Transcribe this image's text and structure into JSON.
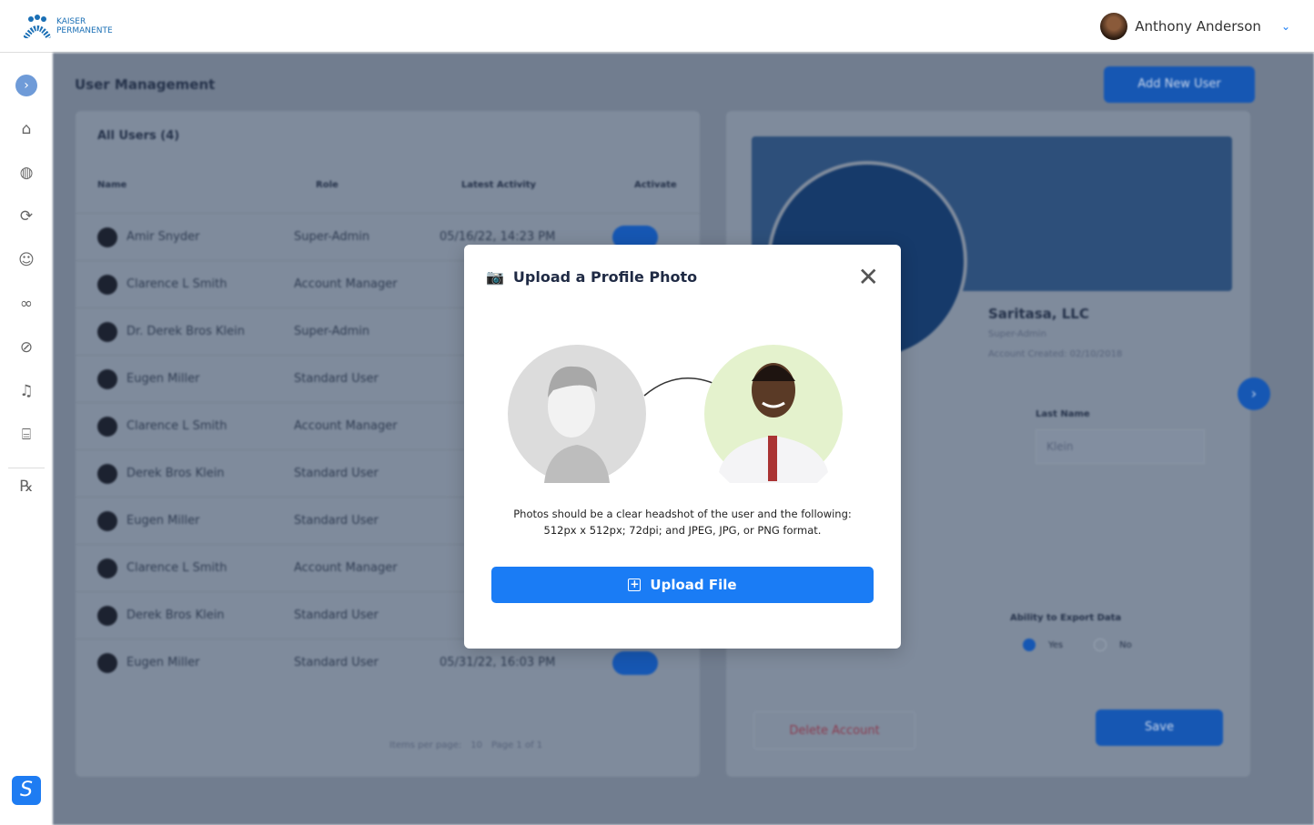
{
  "header": {
    "logo_line1": "KAISER",
    "logo_line2": "PERMANENTE",
    "user_name": "Anthony Anderson"
  },
  "sidebar": {
    "items": [
      "home-icon",
      "globe-icon",
      "sync-icon",
      "user-icon",
      "binoculars-icon",
      "pills-icon",
      "bell-icon",
      "bank-icon",
      "rx-icon"
    ],
    "brand": "S"
  },
  "page": {
    "title": "User Management",
    "add_button": "Add New User",
    "list_title": "All Users (4)",
    "columns": [
      "Name",
      "Role",
      "Latest Activity",
      "Activate"
    ],
    "rows": [
      {
        "name": "Amir Snyder",
        "role": "Super-Admin",
        "activity": "05/16/22, 14:23 PM"
      },
      {
        "name": "Clarence L Smith",
        "role": "Account Manager",
        "activity": ""
      },
      {
        "name": "Dr. Derek Bros Klein",
        "role": "Super-Admin",
        "activity": ""
      },
      {
        "name": "Eugen Miller",
        "role": "Standard User",
        "activity": ""
      },
      {
        "name": "Clarence L Smith",
        "role": "Account Manager",
        "activity": ""
      },
      {
        "name": "Derek Bros Klein",
        "role": "Standard User",
        "activity": ""
      },
      {
        "name": "Eugen Miller",
        "role": "Standard User",
        "activity": ""
      },
      {
        "name": "Clarence L Smith",
        "role": "Account Manager",
        "activity": ""
      },
      {
        "name": "Derek Bros Klein",
        "role": "Standard User",
        "activity": ""
      },
      {
        "name": "Eugen Miller",
        "role": "Standard User",
        "activity": "05/31/22, 16:03 PM"
      }
    ],
    "pagination": {
      "items_per_page": "Items per page:",
      "per_page": "10",
      "page": "Page 1 of 1"
    },
    "profile": {
      "company": "Saritasa, LLC",
      "role": "Super-Admin",
      "created": "Account Created: 02/10/2018",
      "last_name_label": "Last Name",
      "last_name": "Klein",
      "export_label": "Ability to Export Data",
      "yes": "Yes",
      "no": "No",
      "delete": "Delete Account",
      "save": "Save"
    }
  },
  "modal": {
    "title": "Upload a Profile Photo",
    "desc1": "Photos should be a clear headshot of the user and the following:",
    "desc2": "512px x 512px; 72dpi; and JPEG, JPG, or PNG format.",
    "upload": "Upload File"
  },
  "colors": {
    "primary": "#1a7cf5",
    "overlay": "#23324b"
  }
}
